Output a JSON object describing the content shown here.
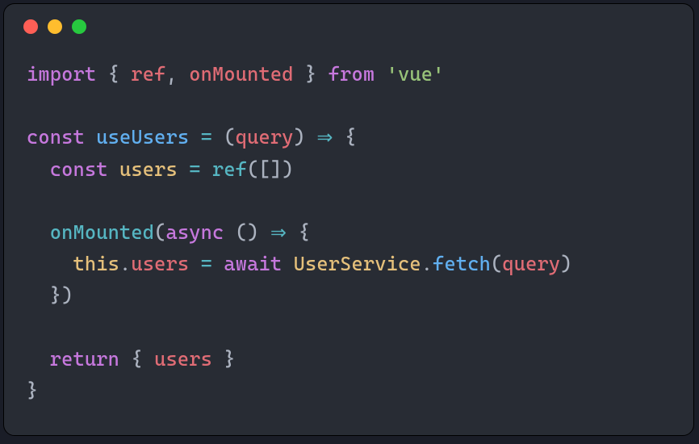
{
  "window": {
    "traffic_lights": [
      "close",
      "minimize",
      "zoom"
    ]
  },
  "code": {
    "lines": [
      [
        {
          "t": "import ",
          "c": "keyword"
        },
        {
          "t": "{ ",
          "c": "punct"
        },
        {
          "t": "ref",
          "c": "prop"
        },
        {
          "t": ", ",
          "c": "punct"
        },
        {
          "t": "onMounted",
          "c": "prop"
        },
        {
          "t": " }",
          "c": "punct"
        },
        {
          "t": " from ",
          "c": "keyword"
        },
        {
          "t": "'vue'",
          "c": "string"
        }
      ],
      [],
      [
        {
          "t": "const ",
          "c": "keyword"
        },
        {
          "t": "useUsers",
          "c": "name"
        },
        {
          "t": " ",
          "c": "punct"
        },
        {
          "t": "=",
          "c": "op"
        },
        {
          "t": " (",
          "c": "punct"
        },
        {
          "t": "query",
          "c": "prop"
        },
        {
          "t": ") ",
          "c": "punct"
        },
        {
          "t": "⇒",
          "c": "arrow"
        },
        {
          "t": " {",
          "c": "punct"
        }
      ],
      [
        {
          "t": "  ",
          "c": "punct"
        },
        {
          "t": "const ",
          "c": "keyword"
        },
        {
          "t": "users",
          "c": "var"
        },
        {
          "t": " ",
          "c": "punct"
        },
        {
          "t": "=",
          "c": "op"
        },
        {
          "t": " ",
          "c": "punct"
        },
        {
          "t": "ref",
          "c": "func"
        },
        {
          "t": "([])",
          "c": "punct"
        }
      ],
      [],
      [
        {
          "t": "  ",
          "c": "punct"
        },
        {
          "t": "onMounted",
          "c": "func"
        },
        {
          "t": "(",
          "c": "punct"
        },
        {
          "t": "async",
          "c": "keyword"
        },
        {
          "t": " () ",
          "c": "punct"
        },
        {
          "t": "⇒",
          "c": "arrow"
        },
        {
          "t": " {",
          "c": "punct"
        }
      ],
      [
        {
          "t": "    ",
          "c": "punct"
        },
        {
          "t": "this",
          "c": "this"
        },
        {
          "t": ".",
          "c": "punct"
        },
        {
          "t": "users",
          "c": "prop"
        },
        {
          "t": " ",
          "c": "punct"
        },
        {
          "t": "=",
          "c": "op"
        },
        {
          "t": " ",
          "c": "punct"
        },
        {
          "t": "await ",
          "c": "keyword"
        },
        {
          "t": "UserService",
          "c": "var"
        },
        {
          "t": ".",
          "c": "punct"
        },
        {
          "t": "fetch",
          "c": "name"
        },
        {
          "t": "(",
          "c": "punct"
        },
        {
          "t": "query",
          "c": "prop"
        },
        {
          "t": ")",
          "c": "punct"
        }
      ],
      [
        {
          "t": "  })",
          "c": "punct"
        }
      ],
      [],
      [
        {
          "t": "  ",
          "c": "punct"
        },
        {
          "t": "return ",
          "c": "keyword"
        },
        {
          "t": "{ ",
          "c": "punct"
        },
        {
          "t": "users",
          "c": "prop"
        },
        {
          "t": " }",
          "c": "punct"
        }
      ],
      [
        {
          "t": "}",
          "c": "punct"
        }
      ]
    ]
  }
}
